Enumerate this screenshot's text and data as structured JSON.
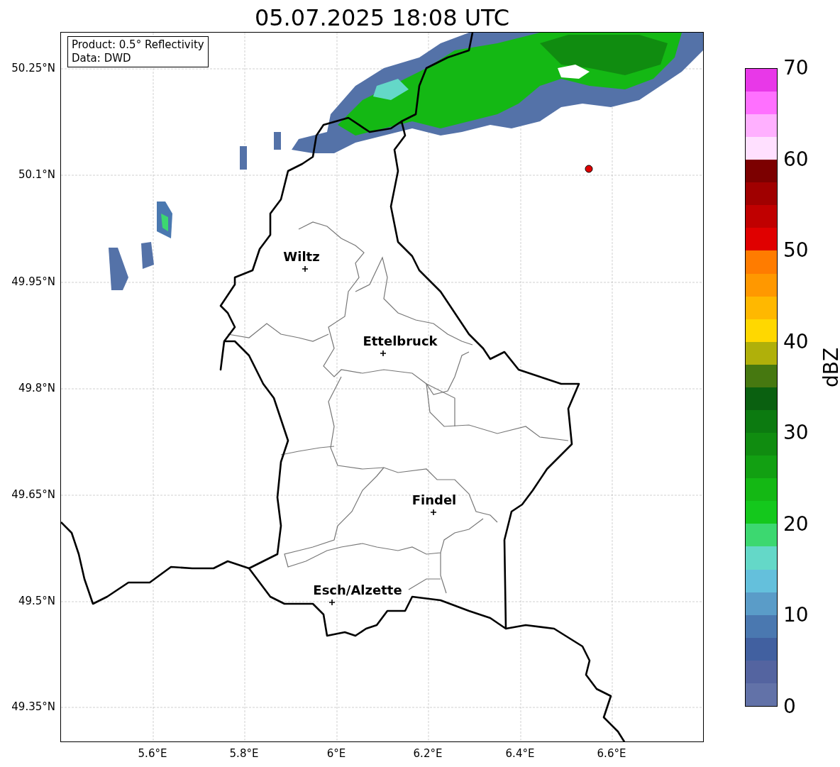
{
  "title": "05.07.2025 18:08 UTC",
  "info_box": [
    "Product: 0.5° Reflectivity",
    "Data: DWD"
  ],
  "x_ticks": [
    "5.6°E",
    "5.8°E",
    "6°E",
    "6.2°E",
    "6.4°E",
    "6.6°E"
  ],
  "y_ticks": [
    "50.25°N",
    "50.1°N",
    "49.95°N",
    "49.8°N",
    "49.65°N",
    "49.5°N",
    "49.35°N"
  ],
  "cities": [
    {
      "label": "Wiltz"
    },
    {
      "label": "Ettelbruck"
    },
    {
      "label": "Findel"
    },
    {
      "label": "Esch/Alzette"
    }
  ],
  "colorbar": {
    "label": "dBZ",
    "ticks": [
      "70",
      "60",
      "50",
      "40",
      "30",
      "20",
      "10",
      "0"
    ],
    "segments": [
      {
        "color": "#6272a8"
      },
      {
        "color": "#5464a0"
      },
      {
        "color": "#4160a0"
      },
      {
        "color": "#4a78b0"
      },
      {
        "color": "#5a9cc8"
      },
      {
        "color": "#64c0dc"
      },
      {
        "color": "#64d8c8"
      },
      {
        "color": "#3cd870"
      },
      {
        "color": "#14c81c"
      },
      {
        "color": "#14b814"
      },
      {
        "color": "#12a012"
      },
      {
        "color": "#108c10"
      },
      {
        "color": "#0c7a10"
      },
      {
        "color": "#0a6010"
      },
      {
        "color": "#467810"
      },
      {
        "color": "#b0b00a"
      },
      {
        "color": "#ffd800"
      },
      {
        "color": "#ffb800"
      },
      {
        "color": "#ff9800"
      },
      {
        "color": "#ff7c00"
      },
      {
        "color": "#e00000"
      },
      {
        "color": "#c00000"
      },
      {
        "color": "#a00000"
      },
      {
        "color": "#7c0000"
      },
      {
        "color": "#ffe0ff"
      },
      {
        "color": "#ffb0ff"
      },
      {
        "color": "#ff70ff"
      },
      {
        "color": "#e838e8"
      }
    ]
  }
}
